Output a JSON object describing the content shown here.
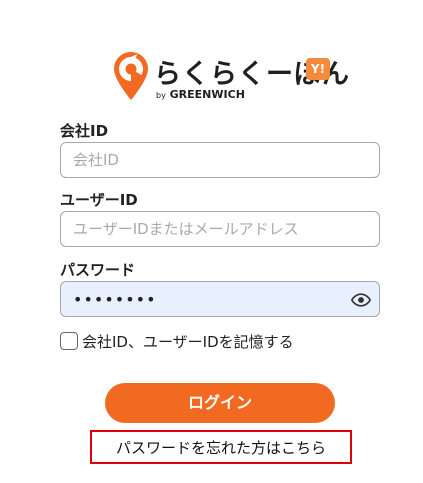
{
  "brand": {
    "name": "らくらくーぽん",
    "badge": "Y!",
    "by": "by",
    "company": "GREENWICH",
    "colors": {
      "accent": "#f26a22",
      "badge": "#f58a3c",
      "highlight": "#e0000b"
    }
  },
  "form": {
    "company_id": {
      "label": "会社ID",
      "placeholder": "会社ID",
      "value": ""
    },
    "user_id": {
      "label": "ユーザーID",
      "placeholder": "ユーザーIDまたはメールアドレス",
      "value": ""
    },
    "password": {
      "label": "パスワード",
      "value": "••••••••",
      "icon": "eye-icon"
    },
    "remember": {
      "label": "会社ID、ユーザーIDを記憶する",
      "checked": false
    }
  },
  "actions": {
    "login_label": "ログイン",
    "forgot_label": "パスワードを忘れた方はこちら"
  }
}
